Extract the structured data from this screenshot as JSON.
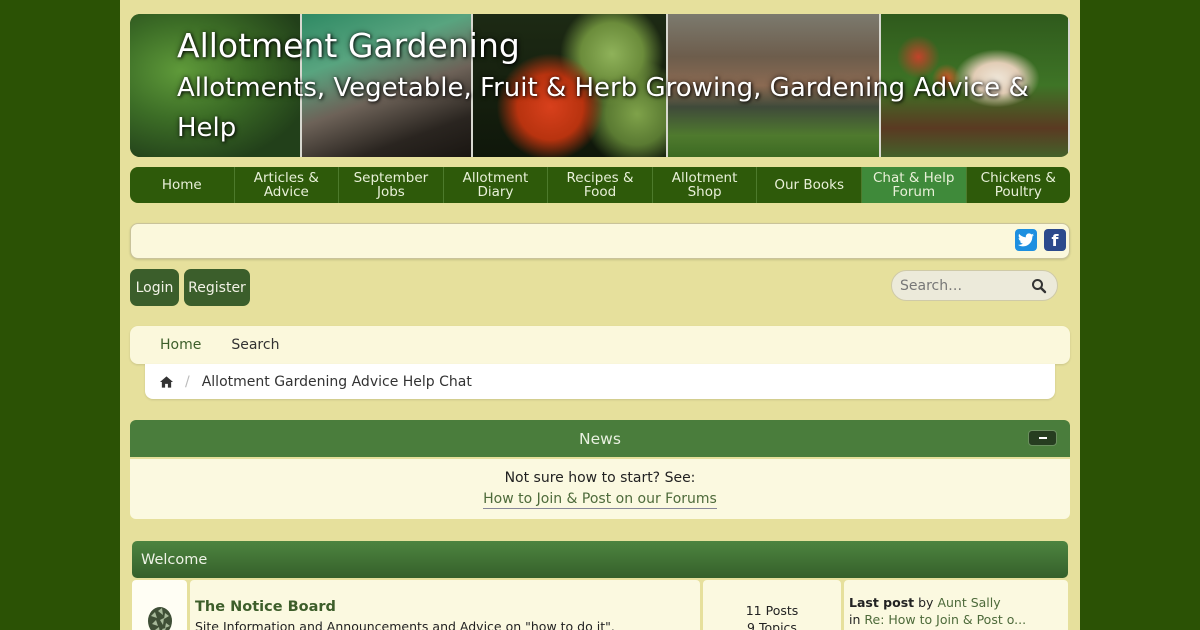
{
  "header": {
    "title": "Allotment Gardening",
    "subtitle": "Allotments, Vegetable, Fruit & Herb Growing, Gardening Advice & Help"
  },
  "navbar": {
    "items": [
      {
        "label": "Home",
        "active": false
      },
      {
        "label": "Articles & Advice",
        "active": false
      },
      {
        "label": "September Jobs",
        "active": false
      },
      {
        "label": "Allotment Diary",
        "active": false
      },
      {
        "label": "Recipes & Food",
        "active": false
      },
      {
        "label": "Allotment Shop",
        "active": false
      },
      {
        "label": "Our Books",
        "active": false
      },
      {
        "label": "Chat & Help Forum",
        "active": true
      },
      {
        "label": "Chickens & Poultry",
        "active": false
      }
    ]
  },
  "social": {
    "twitter_icon": "twitter-icon",
    "facebook_icon": "facebook-icon",
    "facebook_glyph": "f"
  },
  "auth": {
    "login_label": "Login",
    "register_label": "Register"
  },
  "search": {
    "placeholder": "Search…",
    "value": ""
  },
  "navpanel": {
    "home_label": "Home",
    "search_label": "Search"
  },
  "breadcrumb": {
    "separator": "/",
    "current": "Allotment Gardening Advice Help Chat"
  },
  "news": {
    "title": "News",
    "line1": "Not sure how to start? See:",
    "link_label": "How to Join & Post on our Forums"
  },
  "category": {
    "title": "Welcome",
    "forums": [
      {
        "title": "The Notice Board",
        "description": "Site Information and Announcements and Advice on \"how to do it\".",
        "posts": "11 Posts",
        "topics": "9 Topics",
        "last_post_label": "Last post",
        "by_label": "by",
        "last_post_author": "Aunt Sally",
        "in_label": "in",
        "last_post_topic": "Re: How to Join & Post o..."
      }
    ]
  },
  "colors": {
    "outer_bg": "#2b5205",
    "page_bg": "#e6e09c",
    "nav_bg": "#2e5a0a",
    "nav_active": "#3f8a3a",
    "button_bg": "#3b5e2b",
    "panel_head": "#4a7d3c",
    "link": "#4d6a3a"
  }
}
